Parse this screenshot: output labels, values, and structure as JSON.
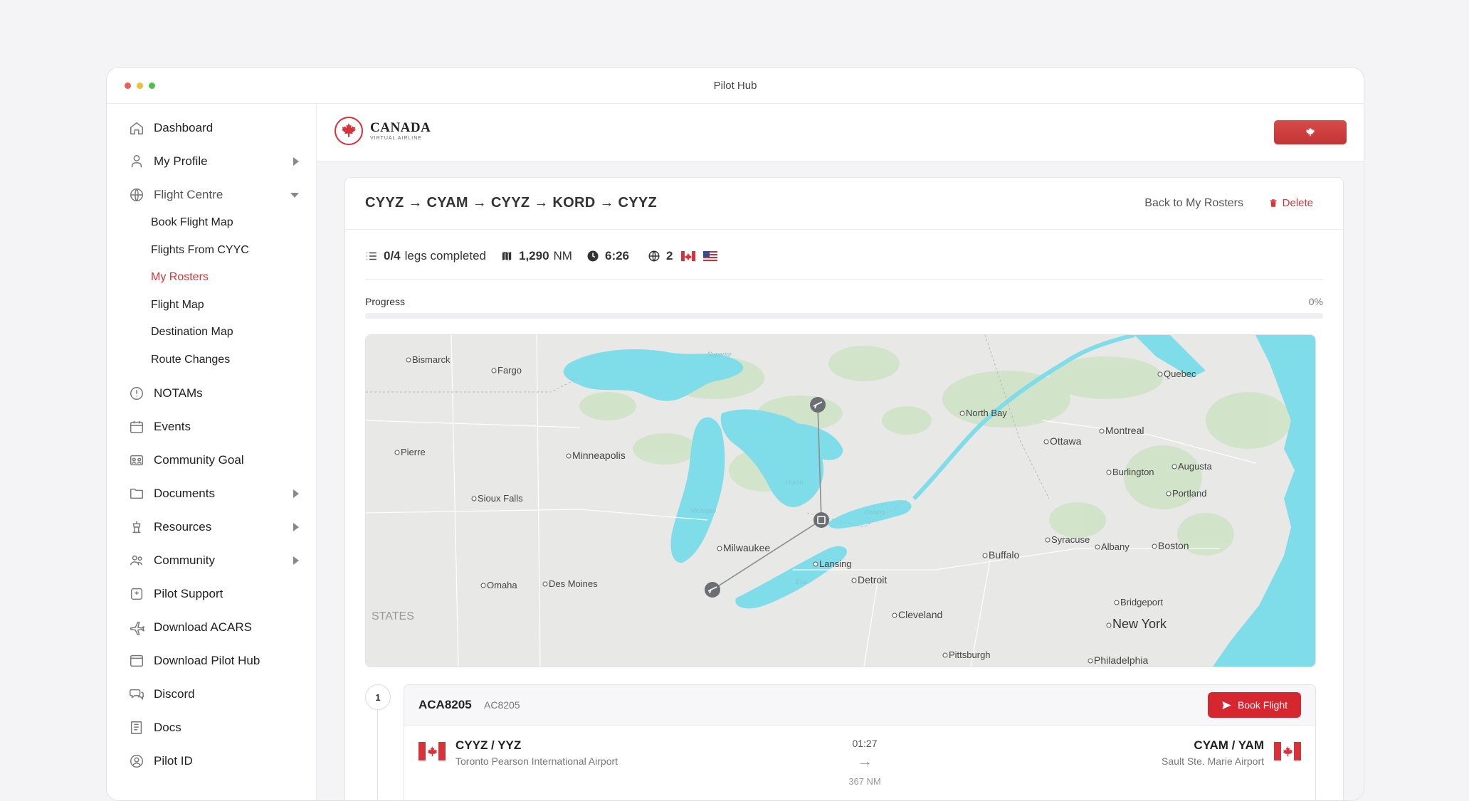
{
  "window": {
    "title": "Pilot Hub",
    "dots": [
      "#ec5e56",
      "#f2be3d",
      "#4fc144"
    ]
  },
  "sidebar": {
    "items": [
      {
        "label": "Dashboard",
        "icon": "home-icon"
      },
      {
        "label": "My Profile",
        "icon": "user-icon",
        "expandable": true
      },
      {
        "label": "Flight Centre",
        "icon": "globe-icon",
        "expanded": true
      },
      {
        "label": "NOTAMs",
        "icon": "alert-icon"
      },
      {
        "label": "Events",
        "icon": "calendar-icon"
      },
      {
        "label": "Community Goal",
        "icon": "goal-icon"
      },
      {
        "label": "Documents",
        "icon": "folder-icon",
        "expandable": true
      },
      {
        "label": "Resources",
        "icon": "tools-icon",
        "expandable": true
      },
      {
        "label": "Community",
        "icon": "people-icon",
        "expandable": true
      },
      {
        "label": "Pilot Support",
        "icon": "support-icon"
      },
      {
        "label": "Download ACARS",
        "icon": "plane-icon"
      },
      {
        "label": "Download Pilot Hub",
        "icon": "window-icon"
      },
      {
        "label": "Discord",
        "icon": "chat-icon"
      },
      {
        "label": "Docs",
        "icon": "book-icon"
      },
      {
        "label": "Pilot ID",
        "icon": "id-icon"
      }
    ],
    "flight_centre": [
      {
        "label": "Book Flight Map"
      },
      {
        "label": "Flights From CYYC"
      },
      {
        "label": "My Rosters",
        "active": true
      },
      {
        "label": "Flight Map"
      },
      {
        "label": "Destination Map"
      },
      {
        "label": "Route Changes"
      }
    ]
  },
  "brand": {
    "name": "CANADA",
    "tagline": "VIRTUAL AIRLINE",
    "accent": "#d6323a"
  },
  "roster": {
    "title": "CYYZ → CYAM → CYYZ → KORD → CYYZ",
    "back_label": "Back to My Rosters",
    "delete_label": "Delete",
    "legs_completed": "0/4",
    "legs_label": "legs completed",
    "distance": "1,290",
    "distance_unit": "NM",
    "duration": "6:26",
    "countries": "2",
    "progress_label": "Progress",
    "progress_pct": "0%",
    "progress_value": 0
  },
  "map": {
    "cities": [
      "Bismarck",
      "Fargo",
      "Pierre",
      "Minneapolis",
      "Sioux Falls",
      "Omaha",
      "Des Moines",
      "Milwaukee",
      "Lansing",
      "Detroit",
      "Cleveland",
      "Pittsburgh",
      "Buffalo",
      "Syracuse",
      "Albany",
      "Boston",
      "Bridgeport",
      "New York",
      "Philadelphia",
      "North Bay",
      "Ottawa",
      "Montreal",
      "Quebec",
      "Burlington",
      "Augusta",
      "Portland"
    ],
    "lake_labels": [
      "Superior",
      "Michigan",
      "Huron",
      "Ontario",
      "Erie"
    ],
    "region_label": "STATES"
  },
  "legs": [
    {
      "number": "1",
      "flight": "ACA8205",
      "callsign": "AC8205",
      "book_label": "Book Flight",
      "dep_code": "CYYZ / YYZ",
      "dep_name": "Toronto Pearson International Airport",
      "arr_code": "CYAM / YAM",
      "arr_name": "Sault Ste. Marie Airport",
      "duration": "01:27",
      "distance": "367 NM"
    }
  ]
}
